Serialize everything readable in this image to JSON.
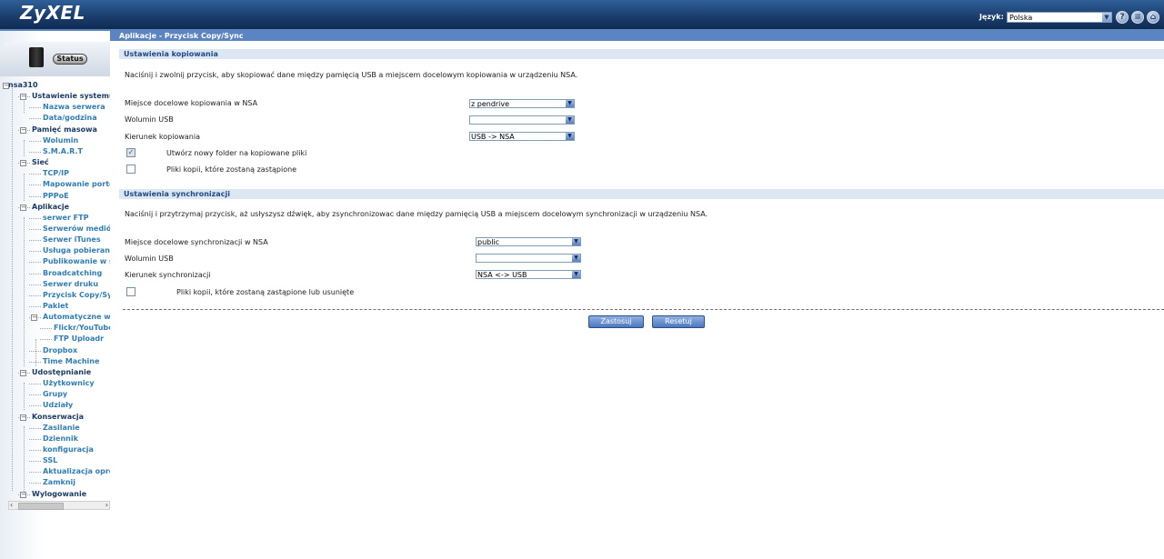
{
  "header": {
    "logo": "ZyXEL",
    "language_label": "Język:",
    "language_value": "Polska",
    "icons": [
      "help-icon",
      "sitemap-icon",
      "home-icon"
    ]
  },
  "sidebar": {
    "status_label": "Status",
    "tree": [
      {
        "label": "nsa310",
        "level": 0
      },
      {
        "label": "Ustawienie systemu",
        "level": 1
      },
      {
        "label": "Nazwa serwera",
        "level": 2
      },
      {
        "label": "Data/godzina",
        "level": 2
      },
      {
        "label": "Pamięć masowa",
        "level": 1
      },
      {
        "label": "Wolumin",
        "level": 2
      },
      {
        "label": "S.M.A.R.T",
        "level": 2
      },
      {
        "label": "Sieć",
        "level": 1
      },
      {
        "label": "TCP/IP",
        "level": 2
      },
      {
        "label": "Mapowanie portów",
        "level": 2
      },
      {
        "label": "PPPoE",
        "level": 2
      },
      {
        "label": "Aplikacje",
        "level": 1
      },
      {
        "label": "serwer FTP",
        "level": 2
      },
      {
        "label": "Serwerów mediów",
        "level": 2
      },
      {
        "label": "Serwer iTunes",
        "level": 2
      },
      {
        "label": "Usługa pobierania",
        "level": 2
      },
      {
        "label": "Publikowanie w sieci",
        "level": 2
      },
      {
        "label": "Broadcatching",
        "level": 2
      },
      {
        "label": "Serwer druku",
        "level": 2
      },
      {
        "label": "Przycisk Copy/Sync",
        "level": 2
      },
      {
        "label": "Pakiet",
        "level": 2
      },
      {
        "label": "Automatyczne wysyłanie",
        "level": 2
      },
      {
        "label": "Flickr/YouTube",
        "level": 3
      },
      {
        "label": "FTP Uploadr",
        "level": 3
      },
      {
        "label": "Dropbox",
        "level": 2
      },
      {
        "label": "Time Machine",
        "level": 2
      },
      {
        "label": "Udostępnianie",
        "level": 1
      },
      {
        "label": "Użytkownicy",
        "level": 2
      },
      {
        "label": "Grupy",
        "level": 2
      },
      {
        "label": "Udziały",
        "level": 2
      },
      {
        "label": "Konserwacja",
        "level": 1
      },
      {
        "label": "Zasilanie",
        "level": 2
      },
      {
        "label": "Dziennik",
        "level": 2
      },
      {
        "label": "konfiguracja",
        "level": 2
      },
      {
        "label": "SSL",
        "level": 2
      },
      {
        "label": "Aktualizacja oprogramowania",
        "level": 2
      },
      {
        "label": "Zamknij",
        "level": 2
      },
      {
        "label": "Wylogowanie",
        "level": 1
      }
    ]
  },
  "main": {
    "page_title": "Aplikacje - Przycisk Copy/Sync",
    "copy": {
      "section_title": "Ustawienia kopiowania",
      "description": "Naciśnij i zwolnij przycisk, aby skopiować dane między pamięcią USB a miejscem docelowym kopiowania w urządzeniu NSA.",
      "target_label": "Miejsce docelowe kopiowania w NSA",
      "target_value": "z pendrive",
      "usb_volume_label": "Wolumin USB",
      "usb_volume_value": "",
      "direction_label": "Kierunek kopiowania",
      "direction_value": "USB -> NSA",
      "new_folder_label": "Utwórz nowy folder na kopiowane pliki",
      "new_folder_checked": true,
      "overwrite_label": "Pliki kopii, które zostaną zastąpione",
      "overwrite_checked": false
    },
    "sync": {
      "section_title": "Ustawienia synchronizacji",
      "description": "Naciśnij i przytrzymaj przycisk, aż usłyszysz dźwięk, aby zsynchronizowac dane między pamięcią USB a miejscem docelowym synchronizacji w urządzeniu NSA.",
      "target_label": "Miejsce docelowe synchronizacji w NSA",
      "target_value": "public",
      "usb_volume_label": "Wolumin USB",
      "usb_volume_value": "",
      "direction_label": "Kierunek synchronizacji",
      "direction_value": "NSA <-> USB",
      "overwrite_label": "Pliki kopii, które zostaną zastąpione lub usunięte",
      "overwrite_checked": false
    },
    "apply_label": "Zastosuj",
    "reset_label": "Resetuj"
  }
}
